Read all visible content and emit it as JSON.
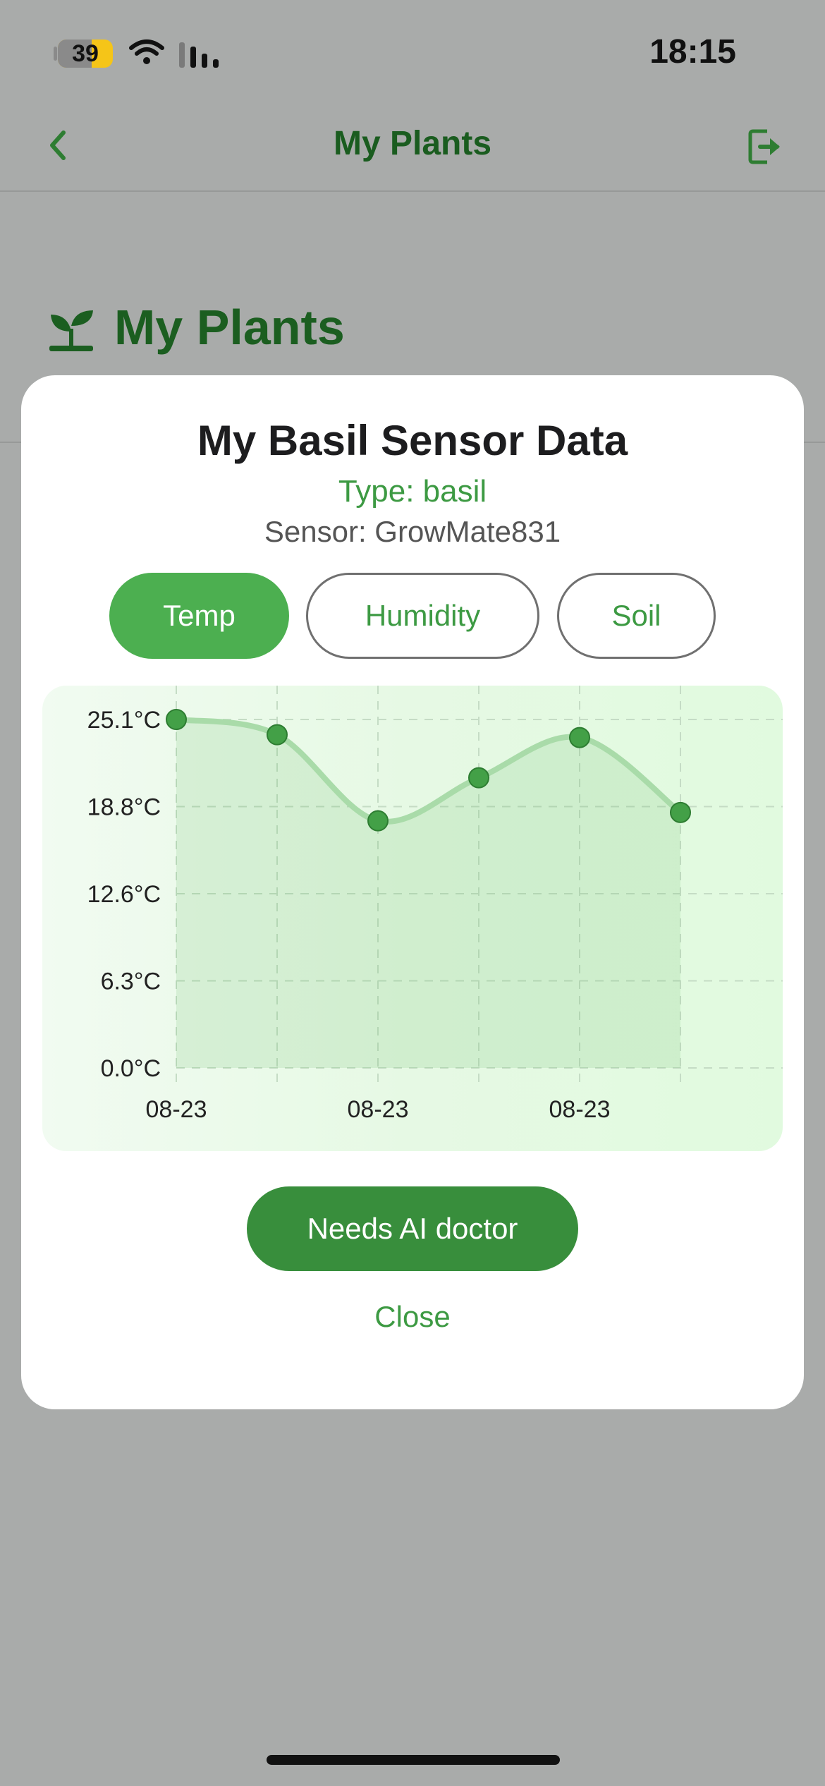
{
  "status_bar": {
    "battery": "39",
    "time": "18:15"
  },
  "nav": {
    "title": "My Plants",
    "back_icon": "chevron-left-icon",
    "logout_icon": "logout-icon"
  },
  "page": {
    "title": "My Plants",
    "icon": "sprout-icon"
  },
  "modal": {
    "title": "My Basil Sensor Data",
    "type_text": "Type: basil",
    "sensor_text": "Sensor: GrowMate831",
    "tabs": [
      {
        "label": "Temp",
        "active": true
      },
      {
        "label": "Humidity",
        "active": false
      },
      {
        "label": "Soil",
        "active": false
      }
    ],
    "ai_button": "Needs AI doctor",
    "close": "Close"
  },
  "colors": {
    "accent": "#4caf50",
    "accent_dark": "#388e3c",
    "title_green": "#1b5e20",
    "overlay": "#a9abaa"
  },
  "chart_data": {
    "type": "line",
    "x": [
      "08-23",
      "08-23",
      "08-23",
      "08-23",
      "08-23",
      "08-23"
    ],
    "x_tick_labels": [
      "08-23",
      "08-23",
      "08-23"
    ],
    "values": [
      25.1,
      24.0,
      17.8,
      20.9,
      23.8,
      18.4
    ],
    "y_tick_labels": [
      "25.1°C",
      "18.8°C",
      "12.6°C",
      "6.3°C",
      "0.0°C"
    ],
    "ylim": [
      0,
      25.1
    ],
    "unit": "°C",
    "area_fill": true,
    "grid": true
  }
}
